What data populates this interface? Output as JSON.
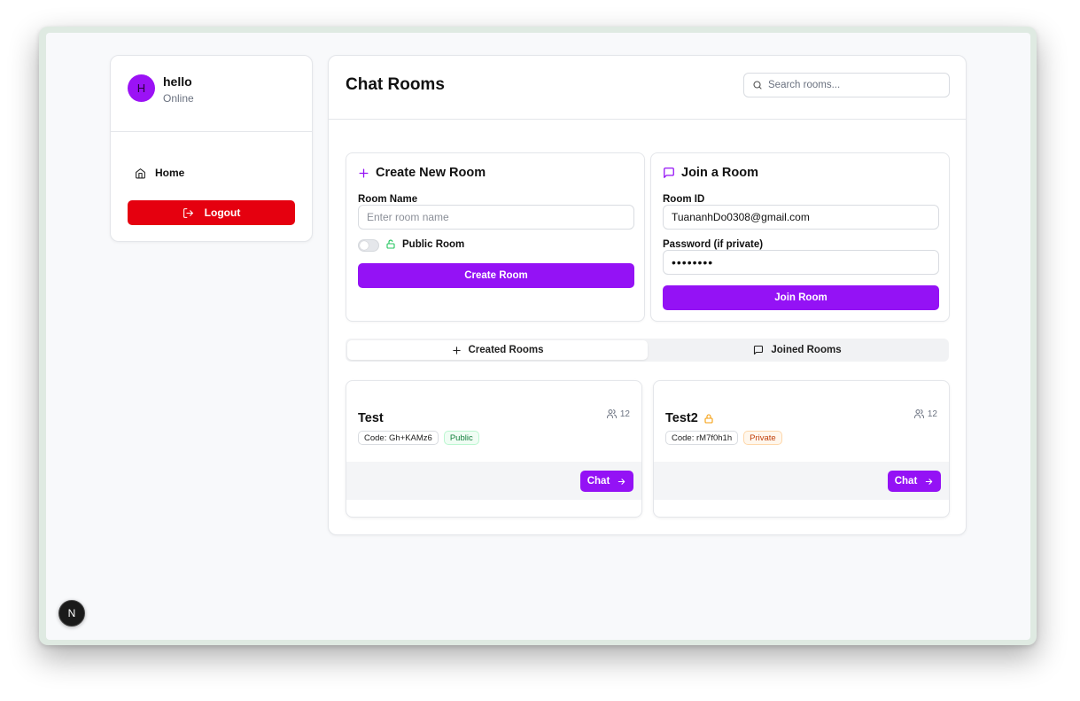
{
  "sidebar": {
    "avatar_letter": "H",
    "username": "hello",
    "status": "Online",
    "nav_home": "Home",
    "logout": "Logout"
  },
  "header": {
    "title": "Chat Rooms",
    "search_placeholder": "Search rooms..."
  },
  "create": {
    "title": "Create New Room",
    "room_name_label": "Room Name",
    "room_name_placeholder": "Enter room name",
    "public_label": "Public Room",
    "button": "Create Room"
  },
  "join": {
    "title": "Join a Room",
    "room_id_label": "Room ID",
    "room_id_value": "TuananhDo0308@gmail.com",
    "password_label": "Password (if private)",
    "password_value": "12345678",
    "button": "Join Room"
  },
  "tabs": {
    "created": "Created Rooms",
    "joined": "Joined Rooms"
  },
  "rooms": [
    {
      "name": "Test",
      "members": "12",
      "code": "Code: Gh+KAMz6",
      "visibility": "Public",
      "chat": "Chat"
    },
    {
      "name": "Test2",
      "members": "12",
      "code": "Code: rM7f0h1h",
      "visibility": "Private",
      "chat": "Chat"
    }
  ],
  "badge": "N",
  "colors": {
    "accent": "#9412f5",
    "danger": "#e5000f",
    "public": "#15803d",
    "private": "#c2410c",
    "lock_open": "#22c55e",
    "lock_closed": "#f59e0b"
  }
}
